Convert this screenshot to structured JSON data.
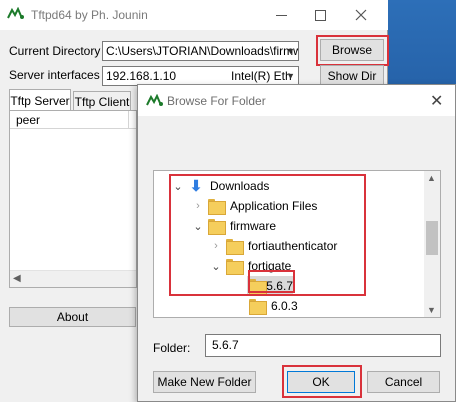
{
  "main_window": {
    "title": "Tftpd64 by Ph. Jounin",
    "current_directory_label": "Current Directory",
    "current_directory_value": "C:\\Users\\JTORIAN\\Downloads\\firmw",
    "server_interfaces_label": "Server interfaces",
    "server_ip": "192.168.1.10",
    "server_adapter": "Intel(R) Eth",
    "browse_label": "Browse",
    "show_dir_label": "Show Dir",
    "tabs": [
      {
        "label": "Tftp Server",
        "active": true
      },
      {
        "label": "Tftp Client",
        "active": false
      }
    ],
    "table_header": "peer",
    "about_label": "About"
  },
  "dialog": {
    "title": "Browse For Folder",
    "tree": [
      {
        "label": "Downloads",
        "state": "expanded",
        "icon": "download-arrow-icon"
      },
      {
        "label": "Application Files",
        "state": "collapsed",
        "icon": "folder-icon"
      },
      {
        "label": "firmware",
        "state": "expanded",
        "icon": "folder-icon"
      },
      {
        "label": "fortiauthenticator",
        "state": "collapsed",
        "icon": "folder-icon"
      },
      {
        "label": "fortigate",
        "state": "expanded",
        "icon": "folder-icon"
      },
      {
        "label": "5.6.7",
        "state": "selected",
        "icon": "folder-icon"
      },
      {
        "label": "6.0.3",
        "state": "none",
        "icon": "folder-icon"
      }
    ],
    "folder_label": "Folder:",
    "folder_value": "5.6.7",
    "make_new_folder_label": "Make New Folder",
    "ok_label": "OK",
    "cancel_label": "Cancel"
  },
  "colors": {
    "highlight": "#d9323b",
    "folder": "#f5ce5c",
    "download_arrow": "#2f7de1"
  }
}
